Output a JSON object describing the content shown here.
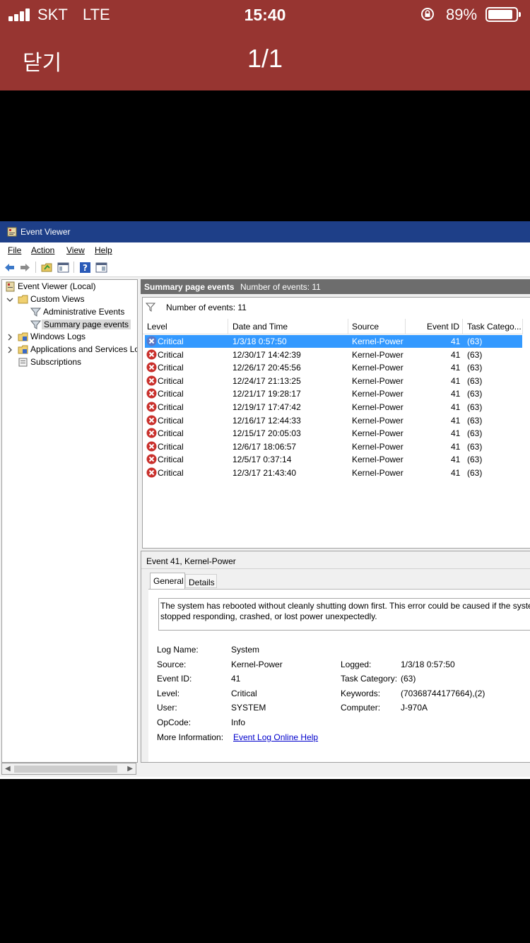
{
  "status": {
    "carrier": "SKT",
    "network": "LTE",
    "time": "15:40",
    "battery_percent": "89%",
    "battery_level": 0.89
  },
  "viewer_header": {
    "close_label": "닫기",
    "page_counter": "1/1"
  },
  "colors": {
    "header_bg": "#973531",
    "titlebar_bg": "#1e3f88",
    "selection": "#3399ff",
    "link": "#0000cc"
  },
  "window": {
    "title": "Event Viewer",
    "menu": [
      "File",
      "Action",
      "View",
      "Help"
    ],
    "toolbar_icons": [
      "back-arrow-icon",
      "forward-arrow-icon",
      "open-folder-icon",
      "properties-icon",
      "help-icon",
      "show-pane-icon"
    ]
  },
  "tree": {
    "root": "Event Viewer (Local)",
    "custom_views": "Custom Views",
    "administrative_events": "Administrative Events",
    "summary_page_events": "Summary page events",
    "windows_logs": "Windows Logs",
    "apps_services": "Applications and Services Lo",
    "subscriptions": "Subscriptions"
  },
  "panel": {
    "title": "Summary page events",
    "count": "Number of events: 11",
    "filter_text": "Number of events: 11"
  },
  "columns": {
    "level": "Level",
    "datetime": "Date and Time",
    "source": "Source",
    "event_id": "Event ID",
    "task": "Task Catego..."
  },
  "events": [
    {
      "level": "Critical",
      "datetime": "1/3/18 0:57:50",
      "source": "Kernel-Power",
      "event_id": "41",
      "task": "(63)"
    },
    {
      "level": "Critical",
      "datetime": "12/30/17 14:42:39",
      "source": "Kernel-Power",
      "event_id": "41",
      "task": "(63)"
    },
    {
      "level": "Critical",
      "datetime": "12/26/17 20:45:56",
      "source": "Kernel-Power",
      "event_id": "41",
      "task": "(63)"
    },
    {
      "level": "Critical",
      "datetime": "12/24/17 21:13:25",
      "source": "Kernel-Power",
      "event_id": "41",
      "task": "(63)"
    },
    {
      "level": "Critical",
      "datetime": "12/21/17 19:28:17",
      "source": "Kernel-Power",
      "event_id": "41",
      "task": "(63)"
    },
    {
      "level": "Critical",
      "datetime": "12/19/17 17:47:42",
      "source": "Kernel-Power",
      "event_id": "41",
      "task": "(63)"
    },
    {
      "level": "Critical",
      "datetime": "12/16/17 12:44:33",
      "source": "Kernel-Power",
      "event_id": "41",
      "task": "(63)"
    },
    {
      "level": "Critical",
      "datetime": "12/15/17 20:05:03",
      "source": "Kernel-Power",
      "event_id": "41",
      "task": "(63)"
    },
    {
      "level": "Critical",
      "datetime": "12/6/17 18:06:57",
      "source": "Kernel-Power",
      "event_id": "41",
      "task": "(63)"
    },
    {
      "level": "Critical",
      "datetime": "12/5/17 0:37:14",
      "source": "Kernel-Power",
      "event_id": "41",
      "task": "(63)"
    },
    {
      "level": "Critical",
      "datetime": "12/3/17 21:43:40",
      "source": "Kernel-Power",
      "event_id": "41",
      "task": "(63)"
    }
  ],
  "detail": {
    "header": "Event 41, Kernel-Power",
    "tab_general": "General",
    "tab_details": "Details",
    "description": "The system has rebooted without cleanly shutting down first. This error could be caused if the system stopped responding, crashed, or lost power unexpectedly.",
    "labels": {
      "log_name": "Log Name:",
      "source": "Source:",
      "event_id": "Event ID:",
      "level": "Level:",
      "user": "User:",
      "opcode": "OpCode:",
      "more_info": "More Information:",
      "logged": "Logged:",
      "task_category": "Task Category:",
      "keywords": "Keywords:",
      "computer": "Computer:"
    },
    "values": {
      "log_name": "System",
      "source": "Kernel-Power",
      "event_id": "41",
      "level": "Critical",
      "user": "SYSTEM",
      "opcode": "Info",
      "more_info_link": "Event Log Online Help",
      "logged": "1/3/18 0:57:50",
      "task_category": "(63)",
      "keywords": "(70368744177664),(2)",
      "computer": "J-970A"
    }
  }
}
